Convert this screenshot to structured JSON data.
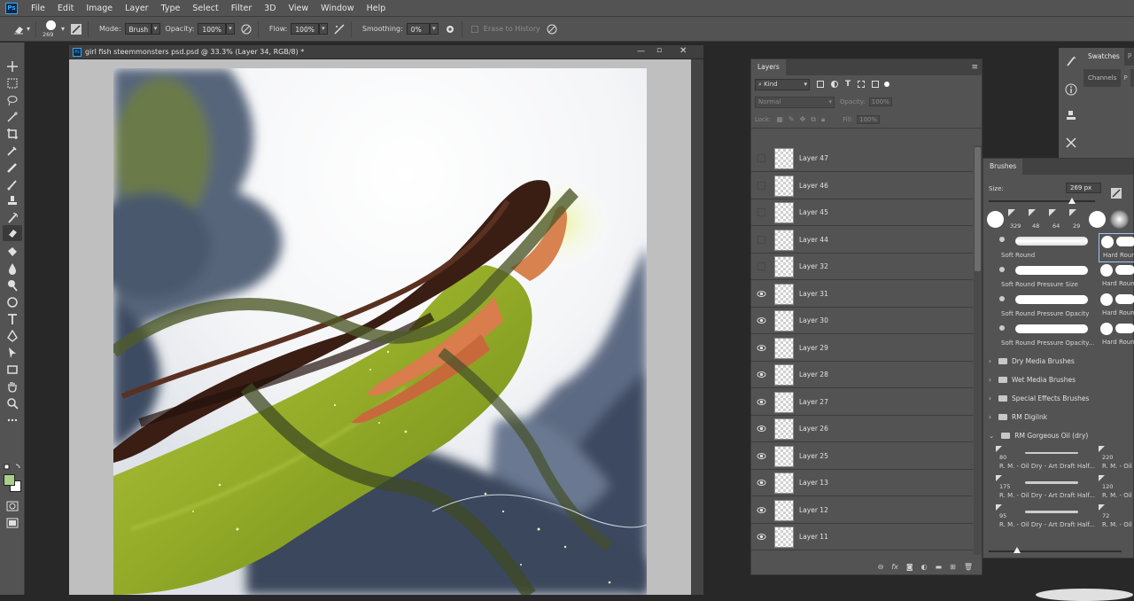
{
  "menubar": {
    "logo": "Ps",
    "items": [
      "File",
      "Edit",
      "Image",
      "Layer",
      "Type",
      "Select",
      "Filter",
      "3D",
      "View",
      "Window",
      "Help"
    ]
  },
  "options": {
    "brush_size": "269",
    "mode_label": "Mode:",
    "mode_value": "Brush",
    "opacity_label": "Opacity:",
    "opacity_value": "100%",
    "flow_label": "Flow:",
    "flow_value": "100%",
    "smoothing_label": "Smoothing:",
    "smoothing_value": "0%",
    "erase_history": "Erase to History"
  },
  "document": {
    "title": "girl fish steemmonsters psd.psd @ 33.3% (Layer 34, RGB/8) *",
    "tab_icon": "Ps"
  },
  "layers_panel": {
    "tab": "Layers",
    "filter_kind": "Kind",
    "blend_mode": "Normal",
    "opacity_label": "Opacity:",
    "opacity_value": "100%",
    "lock_label": "Lock:",
    "fill_label": "Fill:",
    "fill_value": "100%",
    "layers": [
      {
        "name": "Layer 47",
        "visible": false
      },
      {
        "name": "Layer 46",
        "visible": false
      },
      {
        "name": "Layer 45",
        "visible": false
      },
      {
        "name": "Layer 44",
        "visible": false
      },
      {
        "name": "Layer 32",
        "visible": false
      },
      {
        "name": "Layer 31",
        "visible": true
      },
      {
        "name": "Layer 30",
        "visible": true
      },
      {
        "name": "Layer 29",
        "visible": true
      },
      {
        "name": "Layer 28",
        "visible": true
      },
      {
        "name": "Layer 27",
        "visible": true
      },
      {
        "name": "Layer 26",
        "visible": true
      },
      {
        "name": "Layer 25",
        "visible": true
      },
      {
        "name": "Layer 13",
        "visible": true
      },
      {
        "name": "Layer 12",
        "visible": true
      },
      {
        "name": "Layer 11",
        "visible": true
      }
    ]
  },
  "brushes_panel": {
    "tab": "Brushes",
    "size_label": "Size:",
    "size_value": "269 px",
    "recent_sizes": [
      "329",
      "48",
      "64",
      "29"
    ],
    "presets_left": [
      "Soft Round",
      "Soft Round Pressure Size",
      "Soft Round Pressure Opacity",
      "Soft Round Pressure Opacity..."
    ],
    "presets_right": [
      "Hard Round",
      "Hard Round",
      "Hard Round",
      "Hard Round"
    ],
    "groups": [
      "Dry Media Brushes",
      "Wet Media Brushes",
      "Special Effects Brushes",
      "RM DigiInk",
      "RM Gorgeous Oil (dry)"
    ],
    "oil_sizes_left": [
      "80",
      "175",
      "95"
    ],
    "oil_sizes_right": [
      "220",
      "120",
      "72"
    ],
    "oil_names_left": [
      "R. M. - Oil Dry - Art Draft Half...",
      "R. M. - Oil Dry - Art Draft Half...",
      "R. M. - Oil Dry - Art Draft Half..."
    ],
    "oil_names_right": [
      "R. M. - Oil",
      "R. M. - Oil",
      "R. M. - Oil"
    ]
  },
  "swatches_panel": {
    "tab": "Swatches",
    "tab2": "Channels",
    "tab3": "P"
  },
  "colors": {
    "foreground": "#a8d08d",
    "background": "#ffffff",
    "dress": "#8ea82a",
    "hair": "#3a1e14"
  }
}
